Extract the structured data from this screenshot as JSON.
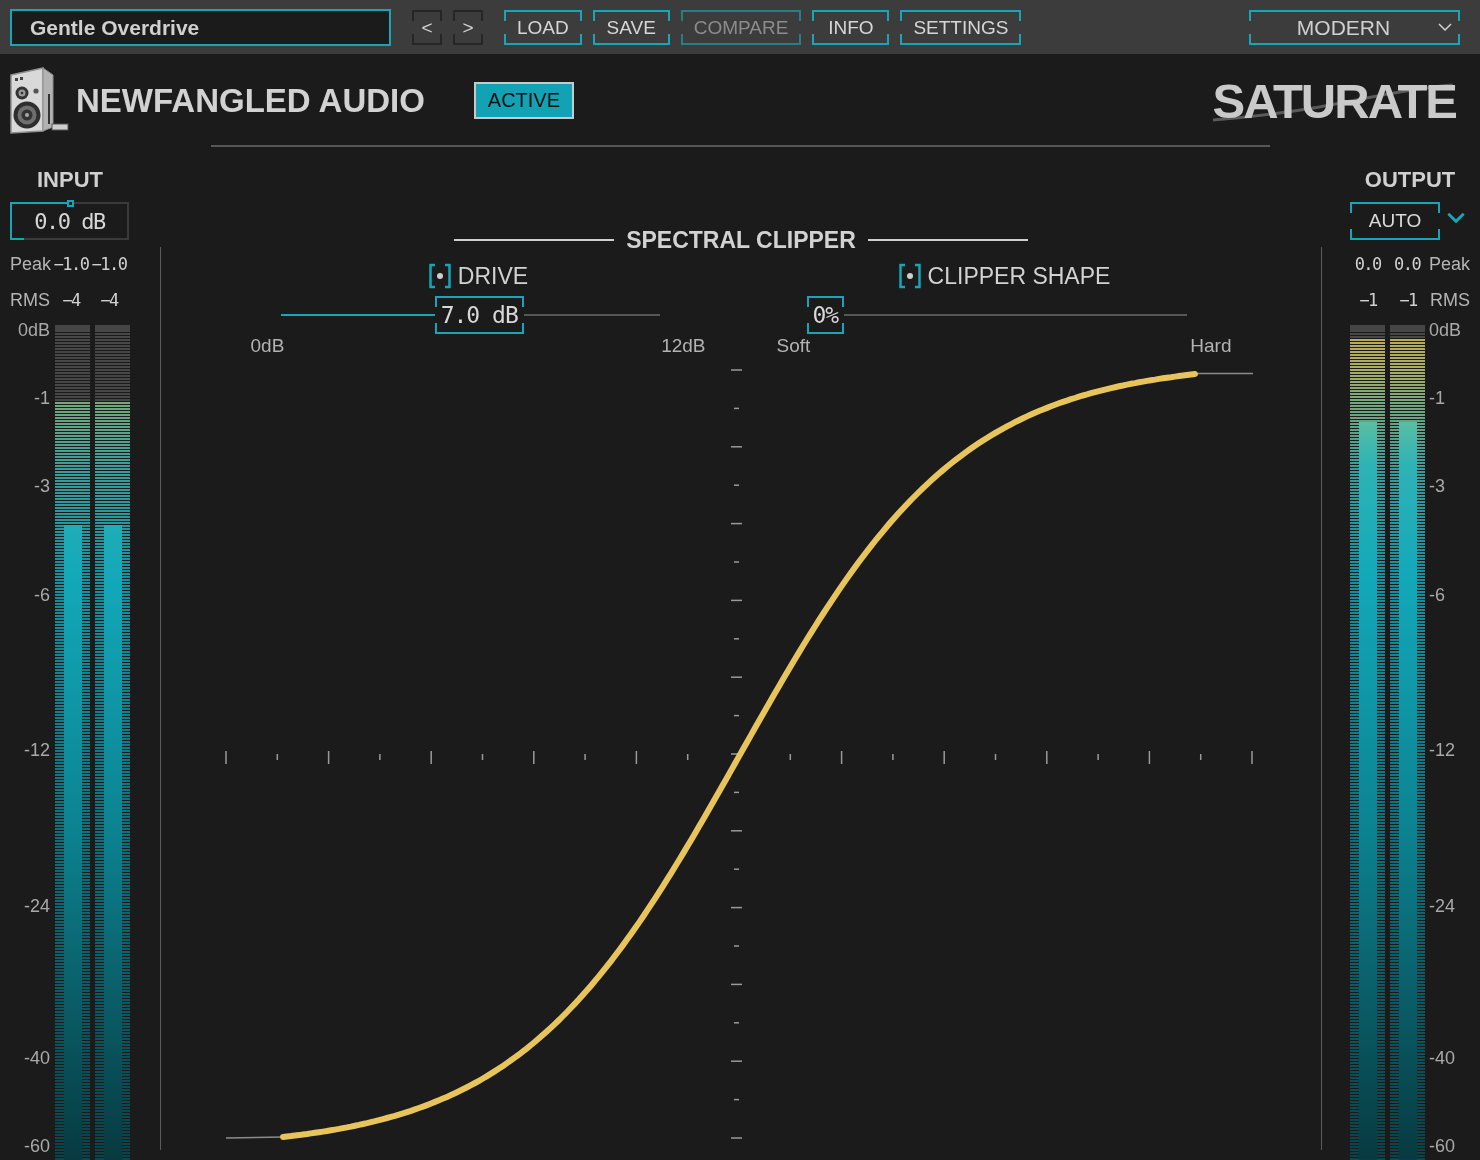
{
  "toolbar": {
    "preset": {
      "value": "Gentle Overdrive"
    },
    "buttons": [
      {
        "label": "<",
        "kind": "nav",
        "disabled": false
      },
      {
        "label": ">",
        "kind": "nav",
        "disabled": false
      },
      {
        "label": "LOAD",
        "kind": "action",
        "disabled": false
      },
      {
        "label": "SAVE",
        "kind": "action",
        "disabled": false
      },
      {
        "label": "COMPARE",
        "kind": "action",
        "disabled": true
      },
      {
        "label": "INFO",
        "kind": "action",
        "disabled": false
      },
      {
        "label": "SETTINGS",
        "kind": "action",
        "disabled": false
      }
    ],
    "mode": {
      "value": "MODERN"
    }
  },
  "header": {
    "brand": "NEWFANGLED AUDIO",
    "active": {
      "label": "ACTIVE",
      "on": true
    },
    "product": "SATURATE"
  },
  "input": {
    "title": "INPUT",
    "gain": {
      "value": "0.0 dB",
      "level": 0.5
    },
    "peak": {
      "label": "Peak",
      "values": [
        "−1.0",
        "−1.0"
      ]
    },
    "rms": {
      "label": "RMS",
      "values": [
        "−4",
        "−4"
      ]
    },
    "meter": {
      "scale": [
        "0dB",
        "-1",
        "-3",
        "-6",
        "-12",
        "-24",
        "-40",
        "-60"
      ],
      "channels": [
        {
          "peak": {
            "level": 0.913
          },
          "rms": {
            "level": 0.765
          }
        },
        {
          "peak": {
            "level": 0.913
          },
          "rms": {
            "level": 0.765
          }
        }
      ]
    }
  },
  "clipper": {
    "title": "SPECTRAL CLIPPER",
    "controls": [
      {
        "label": "DRIVE",
        "value": "7.0 dB",
        "level": 0.53,
        "min_label": "0dB",
        "max_label": "12dB"
      },
      {
        "label": "CLIPPER SHAPE",
        "value": "0%",
        "level": 0,
        "min_label": "Soft",
        "max_label": "Hard"
      }
    ]
  },
  "output": {
    "title": "OUTPUT",
    "mode": {
      "value": "AUTO"
    },
    "peak": {
      "label": "Peak",
      "values": [
        "0.0",
        "0.0"
      ]
    },
    "rms": {
      "label": "RMS",
      "values": [
        "−1",
        "−1"
      ]
    },
    "meter": {
      "scale": [
        "0dB",
        "-1",
        "-3",
        "-6",
        "-12",
        "-24",
        "-40",
        "-60"
      ],
      "channels": [
        {
          "peak": {
            "level": 0.99
          },
          "rms": {
            "level": 0.889
          }
        },
        {
          "peak": {
            "level": 0.99
          },
          "rms": {
            "level": 0.889
          }
        }
      ]
    }
  }
}
